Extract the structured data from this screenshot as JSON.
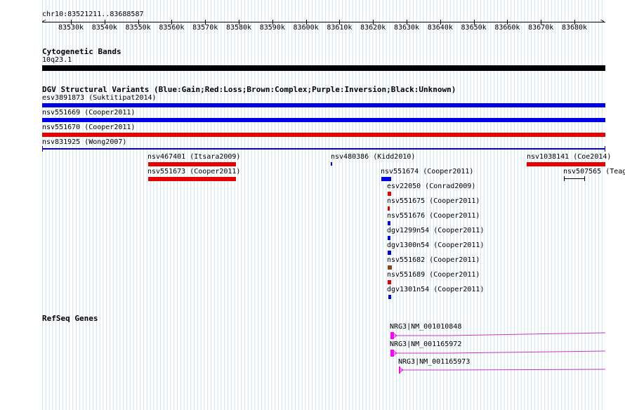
{
  "coordinate_label": "chr10:83521211..83688587",
  "ruler_ticks": [
    "83530k",
    "83540k",
    "83550k",
    "83560k",
    "83570k",
    "83580k",
    "83590k",
    "83600k",
    "83610k",
    "83620k",
    "83630k",
    "83640k",
    "83650k",
    "83660k",
    "83670k",
    "83680k"
  ],
  "sections": {
    "cyto_title": "Cytogenetic Bands",
    "dgv_title": "DGV Structural Variants (Blue:Gain;Red:Loss;Brown:Complex;Purple:Inversion;Black:Unknown)",
    "refseq_title": "RefSeq Genes"
  },
  "cytoband": {
    "label": "10q23.1",
    "color": "#000000"
  },
  "colors": {
    "gain": "#0000e6",
    "loss": "#e60000",
    "complex": "#8b4513",
    "unknown": "#000000",
    "gene": "#cc33cc",
    "gene_exon": "#ff00ff",
    "grid": "#cfe3ec"
  },
  "variants": [
    {
      "label": "esv3891873 (Suktitipat2014)",
      "type": "gain"
    },
    {
      "label": "nsv551669 (Cooper2011)",
      "type": "gain"
    },
    {
      "label": "nsv551670 (Cooper2011)",
      "type": "loss"
    },
    {
      "label": "nsv831925 (Wong2007)",
      "type": "gain"
    },
    {
      "label": "nsv467401 (Itsara2009)",
      "type": "loss"
    },
    {
      "label": "nsv480386 (Kidd2010)",
      "type": "gain"
    },
    {
      "label": "nsv1038141 (Coe2014)",
      "type": "loss"
    },
    {
      "label": "nsv551673 (Cooper2011)",
      "type": "loss"
    },
    {
      "label": "nsv551674 (Cooper2011)",
      "type": "gain"
    },
    {
      "label": "nsv507565 (Teag",
      "type": "unknown"
    },
    {
      "label": "esv22050 (Conrad2009)",
      "type": "loss"
    },
    {
      "label": "nsv551675 (Cooper2011)",
      "type": "loss"
    },
    {
      "label": "nsv551676 (Cooper2011)",
      "type": "gain"
    },
    {
      "label": "dgv1299n54 (Cooper2011)",
      "type": "gain"
    },
    {
      "label": "dgv1300n54 (Cooper2011)",
      "type": "gain"
    },
    {
      "label": "nsv551682 (Cooper2011)",
      "type": "complex"
    },
    {
      "label": "nsv551689 (Cooper2011)",
      "type": "loss"
    },
    {
      "label": "dgv1301n54 (Cooper2011)",
      "type": "gain"
    }
  ],
  "genes": [
    {
      "label": "NRG3|NM_001010848"
    },
    {
      "label": "NRG3|NM_001165972"
    },
    {
      "label": "NRG3|NM_001165973"
    }
  ]
}
